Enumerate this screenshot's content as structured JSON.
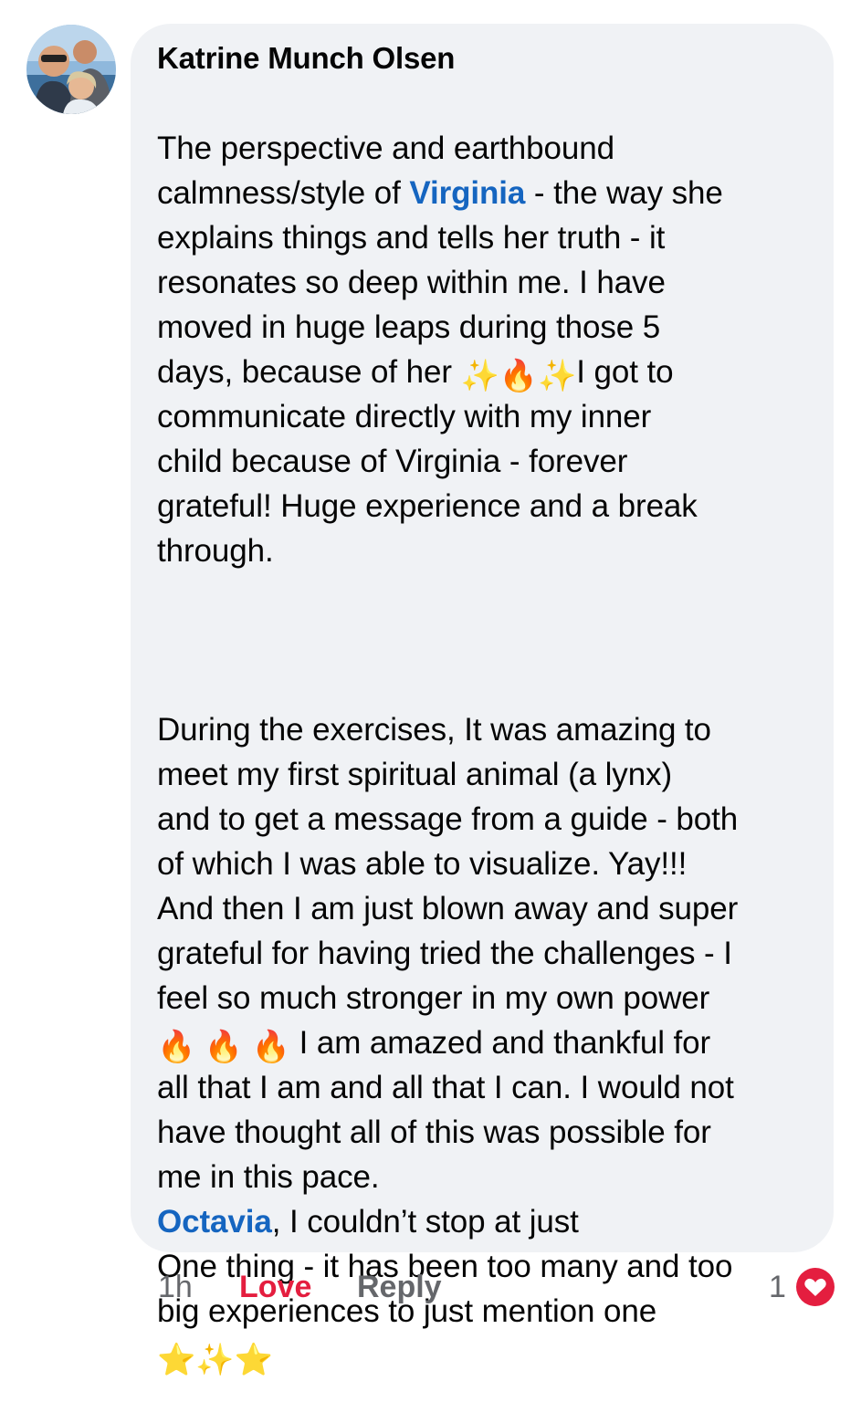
{
  "comment": {
    "author": "Katrine Munch Olsen",
    "paragraph1": [
      [
        {
          "t": "The perspective and earthbound"
        }
      ],
      [
        {
          "t": "calmness/style of "
        },
        {
          "t": "Virginia",
          "mention": true
        },
        {
          "t": " - the way she"
        }
      ],
      [
        {
          "t": "explains things and tells her truth - it"
        }
      ],
      [
        {
          "t": "resonates so deep within me. I have"
        }
      ],
      [
        {
          "t": "moved in huge leaps during those 5"
        }
      ],
      [
        {
          "t": "days, because of her "
        },
        {
          "e": "✨",
          "k": "spark"
        },
        {
          "e": "🔥",
          "k": "fire"
        },
        {
          "e": "✨",
          "k": "spark"
        },
        {
          "t": "I got to"
        }
      ],
      [
        {
          "t": "communicate directly with my inner"
        }
      ],
      [
        {
          "t": "child because of Virginia -  forever"
        }
      ],
      [
        {
          "t": "grateful! Huge experience and a break"
        }
      ],
      [
        {
          "t": "through."
        }
      ]
    ],
    "paragraph2": [
      [
        {
          "t": "During the exercises, It was amazing to"
        }
      ],
      [
        {
          "t": "meet my first spiritual animal (a lynx)"
        }
      ],
      [
        {
          "t": "and to get a message from a guide - both"
        }
      ],
      [
        {
          "t": "of which I was able to visualize. Yay!!!"
        }
      ],
      [
        {
          "t": "And then I am just blown away and super"
        }
      ],
      [
        {
          "t": "grateful for having tried the challenges - I"
        }
      ],
      [
        {
          "t": "feel so much stronger in my own power"
        }
      ],
      [
        {
          "e": "🔥",
          "k": "fire"
        },
        {
          "t": " "
        },
        {
          "e": "🔥",
          "k": "fire"
        },
        {
          "t": " "
        },
        {
          "e": "🔥",
          "k": "fire"
        },
        {
          "t": " I am amazed and thankful for"
        }
      ],
      [
        {
          "t": "all that I am and all that I can. I would not"
        }
      ],
      [
        {
          "t": "have thought all of this was possible for"
        }
      ],
      [
        {
          "t": "me in this pace."
        }
      ],
      [
        {
          "t": "Octavia",
          "mention": true
        },
        {
          "t": ", I couldn’t stop at just"
        }
      ],
      [
        {
          "t": "One thing - it has been too many and too"
        }
      ],
      [
        {
          "t": "big experiences to just mention one"
        }
      ],
      [
        {
          "e": "⭐",
          "k": "star"
        },
        {
          "e": "✨",
          "k": "spark"
        },
        {
          "e": "⭐",
          "k": "star"
        }
      ]
    ]
  },
  "actions": {
    "time": "1h",
    "love": "Love",
    "reply": "Reply",
    "reaction_count": "1"
  },
  "icons": {
    "reaction": "heart-icon",
    "avatar": "profile-photo"
  },
  "colors": {
    "bubble": "#f0f2f5",
    "mention": "#1565c0",
    "love": "#e41e3f",
    "meta": "#65676b"
  }
}
